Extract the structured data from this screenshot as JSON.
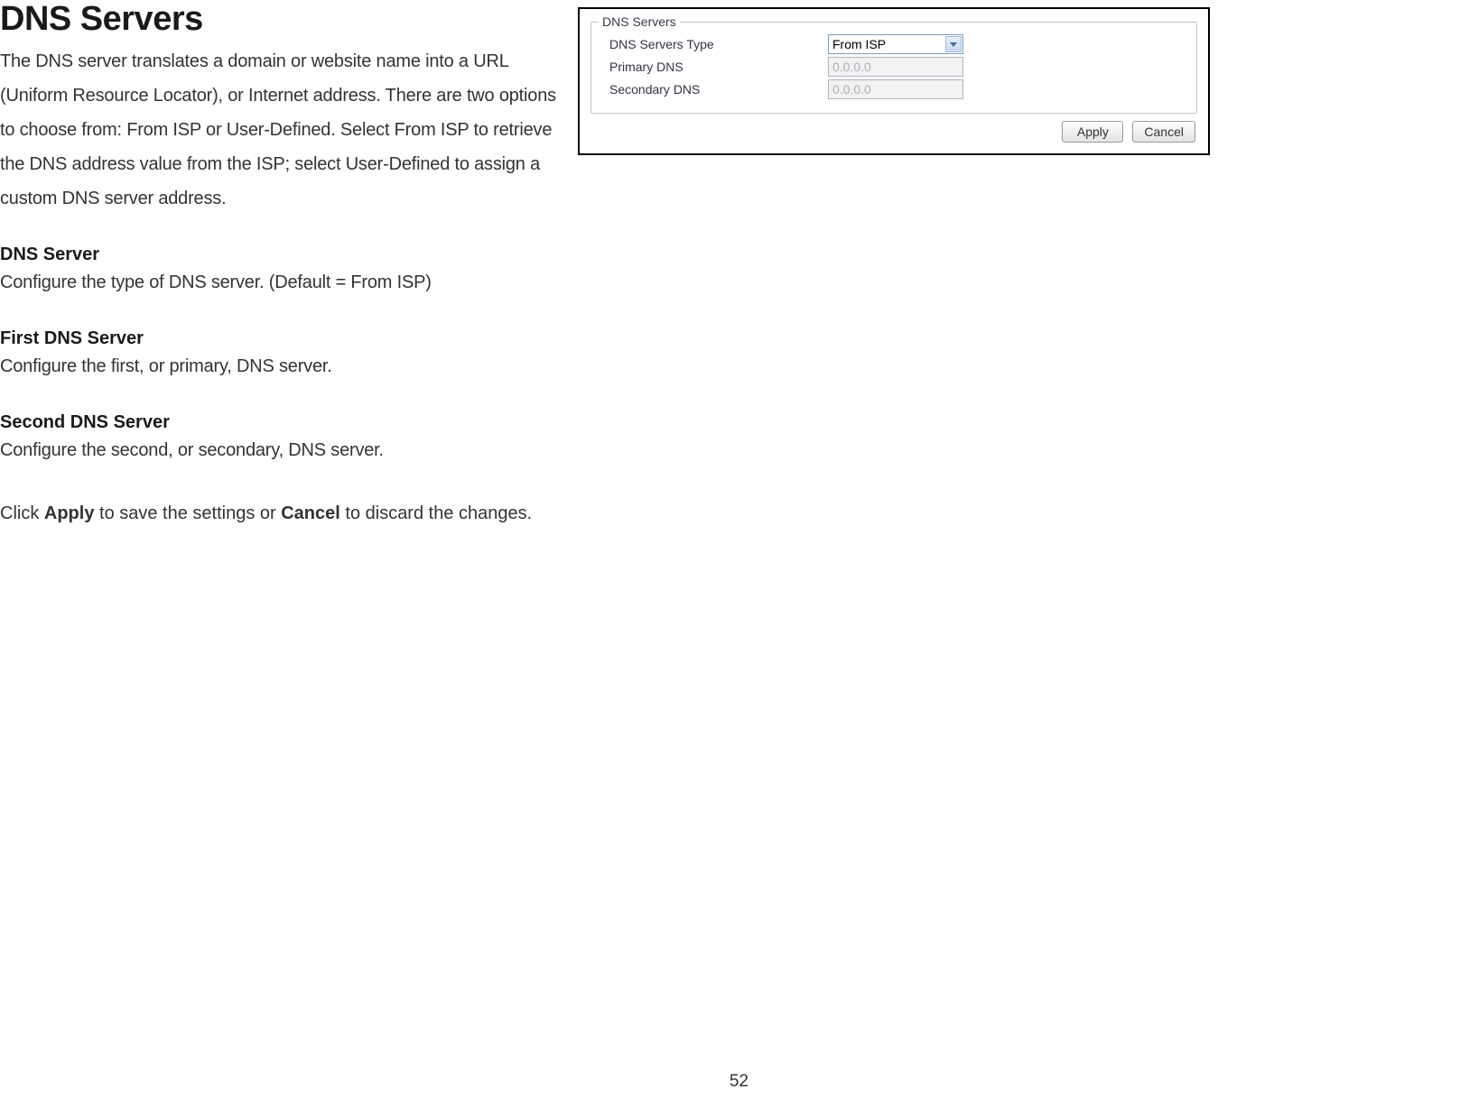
{
  "doc": {
    "title": "DNS Servers",
    "intro": "The DNS server translates a domain or website name into a URL (Uniform Resource Locator), or Internet address. There are two options to choose from: From ISP or User-Defined. Select From ISP to retrieve the DNS address value from the ISP; select User-Defined to assign a custom DNS server address.",
    "sections": [
      {
        "heading": "DNS Server",
        "body": "Configure the type of DNS server. (Default = From ISP)"
      },
      {
        "heading": "First DNS Server",
        "body": "Configure the first, or primary, DNS server."
      },
      {
        "heading": "Second DNS Server",
        "body": "Configure the second, or secondary, DNS server."
      }
    ],
    "footer_parts": {
      "pre": "Click ",
      "apply": "Apply",
      "mid": " to save the settings or ",
      "cancel": "Cancel",
      "post": " to discard the changes."
    },
    "page_number": "52"
  },
  "panel": {
    "fieldset_title": "DNS Servers",
    "rows": {
      "type_label": "DNS Servers Type",
      "type_value": "From ISP",
      "primary_label": "Primary DNS",
      "primary_value": "0.0.0.0",
      "secondary_label": "Secondary DNS",
      "secondary_value": "0.0.0.0"
    },
    "buttons": {
      "apply": "Apply",
      "cancel": "Cancel"
    }
  }
}
